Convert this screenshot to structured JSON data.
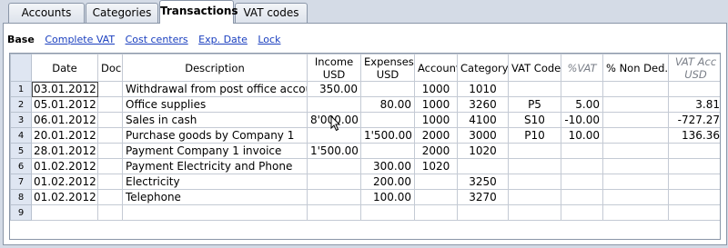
{
  "tabs": [
    {
      "label": "Accounts"
    },
    {
      "label": "Categories"
    },
    {
      "label": "Transactions"
    },
    {
      "label": "VAT codes"
    }
  ],
  "views": {
    "base": "Base",
    "links": [
      "Complete VAT",
      "Cost centers",
      "Exp. Date",
      "Lock"
    ]
  },
  "table": {
    "headers": {
      "date": "Date",
      "doc": "Doc",
      "description": "Description",
      "income": [
        "Income",
        "USD"
      ],
      "expenses": [
        "Expenses",
        "USD"
      ],
      "account": "Account",
      "category": "Category",
      "vat_code": "VAT Code",
      "pct_vat": "%VAT",
      "pct_non_ded": "% Non Ded.",
      "vat_acc": [
        "VAT Acc",
        "USD"
      ]
    },
    "rows": [
      {
        "n": "1",
        "date": "03.01.2012",
        "doc": "",
        "description": "Withdrawal from post office account",
        "income": "350.00",
        "expenses": "",
        "account": "1000",
        "category": "1010",
        "vat_code": "",
        "pct_vat": "",
        "pct_non_ded": "",
        "vat_acc": ""
      },
      {
        "n": "2",
        "date": "05.01.2012",
        "doc": "",
        "description": "Office supplies",
        "income": "",
        "expenses": "80.00",
        "account": "1000",
        "category": "3260",
        "vat_code": "P5",
        "pct_vat": "5.00",
        "pct_non_ded": "",
        "vat_acc": "3.81"
      },
      {
        "n": "3",
        "date": "06.01.2012",
        "doc": "",
        "description": "Sales in cash",
        "income": "8'000.00",
        "expenses": "",
        "account": "1000",
        "category": "4100",
        "vat_code": "S10",
        "pct_vat": "-10.00",
        "pct_non_ded": "",
        "vat_acc": "-727.27"
      },
      {
        "n": "4",
        "date": "20.01.2012",
        "doc": "",
        "description": "Purchase goods by Company 1",
        "income": "",
        "expenses": "1'500.00",
        "account": "2000",
        "category": "3000",
        "vat_code": "P10",
        "pct_vat": "10.00",
        "pct_non_ded": "",
        "vat_acc": "136.36"
      },
      {
        "n": "5",
        "date": "28.01.2012",
        "doc": "",
        "description": "Payment Company 1 invoice",
        "income": "1'500.00",
        "expenses": "",
        "account": "2000",
        "category": "1020",
        "vat_code": "",
        "pct_vat": "",
        "pct_non_ded": "",
        "vat_acc": ""
      },
      {
        "n": "6",
        "date": "01.02.2012",
        "doc": "",
        "description": "Payment Electricity and Phone",
        "income": "",
        "expenses": "300.00",
        "account": "1020",
        "category": "",
        "vat_code": "",
        "pct_vat": "",
        "pct_non_ded": "",
        "vat_acc": ""
      },
      {
        "n": "7",
        "date": "01.02.2012",
        "doc": "",
        "description": "Electricity",
        "income": "",
        "expenses": "200.00",
        "account": "",
        "category": "3250",
        "vat_code": "",
        "pct_vat": "",
        "pct_non_ded": "",
        "vat_acc": ""
      },
      {
        "n": "8",
        "date": "01.02.2012",
        "doc": "",
        "description": "Telephone",
        "income": "",
        "expenses": "100.00",
        "account": "",
        "category": "3270",
        "vat_code": "",
        "pct_vat": "",
        "pct_non_ded": "",
        "vat_acc": ""
      },
      {
        "n": "9",
        "date": "",
        "doc": "",
        "description": "",
        "income": "",
        "expenses": "",
        "account": "",
        "category": "",
        "vat_code": "",
        "pct_vat": "",
        "pct_non_ded": "",
        "vat_acc": ""
      }
    ],
    "selected_row": 0
  },
  "colors": {
    "row_header": "#dfe6f2",
    "grid_line": "#c4cad4",
    "link": "#1a3fbf"
  },
  "icons": {
    "cursor": "mouse-pointer-icon"
  }
}
